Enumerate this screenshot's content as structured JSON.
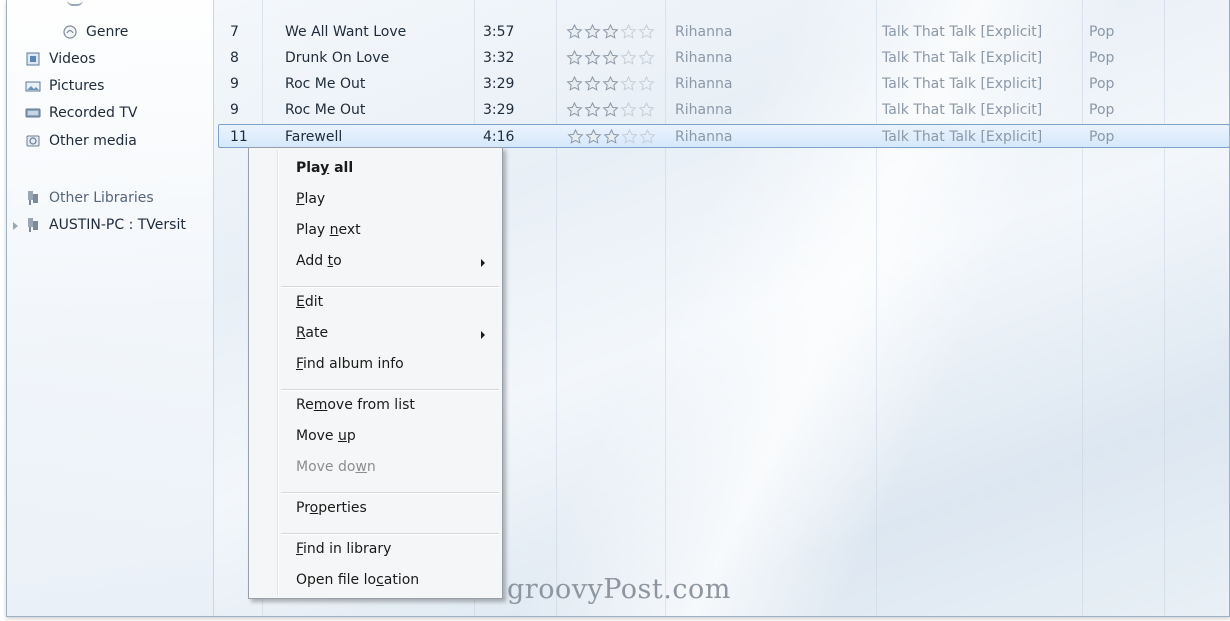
{
  "nav": {
    "items": [
      {
        "label": "Genre",
        "icon": "genre-icon"
      },
      {
        "label": "Videos",
        "icon": "videos-icon"
      },
      {
        "label": "Pictures",
        "icon": "pictures-icon"
      },
      {
        "label": "Recorded TV",
        "icon": "recorded-tv-icon"
      },
      {
        "label": "Other media",
        "icon": "other-media-icon"
      },
      {
        "label": "Other Libraries",
        "icon": "other-libraries-icon"
      },
      {
        "label": "AUSTIN-PC : TVersit",
        "icon": "shared-library-icon"
      }
    ]
  },
  "tracks": [
    {
      "num": "7",
      "title": "We All Want Love",
      "length": "3:57",
      "rating": 3,
      "artist": "Rihanna",
      "album": "Talk That Talk [Explicit]",
      "genre": "Pop"
    },
    {
      "num": "8",
      "title": "Drunk On Love",
      "length": "3:32",
      "rating": 3,
      "artist": "Rihanna",
      "album": "Talk That Talk [Explicit]",
      "genre": "Pop"
    },
    {
      "num": "9",
      "title": "Roc Me Out",
      "length": "3:29",
      "rating": 3,
      "artist": "Rihanna",
      "album": "Talk That Talk [Explicit]",
      "genre": "Pop"
    },
    {
      "num": "9",
      "title": "Roc Me Out",
      "length": "3:29",
      "rating": 3,
      "artist": "Rihanna",
      "album": "Talk That Talk [Explicit]",
      "genre": "Pop"
    },
    {
      "num": "11",
      "title": "Farewell",
      "length": "4:16",
      "rating": 3,
      "artist": "Rihanna",
      "album": "Talk That Talk [Explicit]",
      "genre": "Pop",
      "selected": true
    }
  ],
  "context_menu": {
    "items": [
      {
        "label": "Play all",
        "underline": "y",
        "bold": true
      },
      {
        "label": "Play",
        "underline": "P"
      },
      {
        "label": "Play next",
        "underline": "n"
      },
      {
        "label": "Add to",
        "underline": "t",
        "submenu": true
      },
      {
        "separator": true
      },
      {
        "label": "Edit",
        "underline": "E"
      },
      {
        "label": "Rate",
        "underline": "R",
        "submenu": true
      },
      {
        "label": "Find album info",
        "underline": "F"
      },
      {
        "separator": true
      },
      {
        "label": "Remove from list",
        "underline": "m"
      },
      {
        "label": "Move up",
        "underline": "u"
      },
      {
        "label": "Move down",
        "underline": "w",
        "disabled": true
      },
      {
        "separator": true
      },
      {
        "label": "Properties",
        "underline": "o"
      },
      {
        "separator": true
      },
      {
        "label": "Find in library",
        "underline": "F"
      },
      {
        "label": "Open file location",
        "underline": "c"
      }
    ]
  },
  "watermark": "groovyPost.com",
  "colors": {
    "selection_border": "#7da2ce",
    "star_outline": "#9aa7b5",
    "disabled_text": "#8d8d8d"
  }
}
